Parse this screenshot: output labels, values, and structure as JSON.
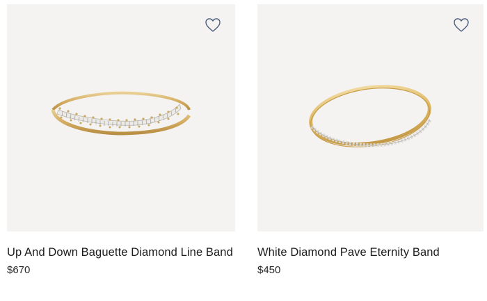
{
  "products": [
    {
      "title": "Up And Down Baguette Diamond Line Band",
      "price": "$670",
      "image_icon": "baguette-diamond-ring-image",
      "wishlist_icon": "heart-outline-icon"
    },
    {
      "title": "White Diamond Pave Eternity Band",
      "price": "$450",
      "image_icon": "pave-eternity-ring-image",
      "wishlist_icon": "heart-outline-icon"
    }
  ],
  "colors": {
    "card_background": "#f4f3f2",
    "gold": "#d8b36a",
    "heart_stroke": "#4a5a78",
    "text": "#1c1c1c"
  }
}
